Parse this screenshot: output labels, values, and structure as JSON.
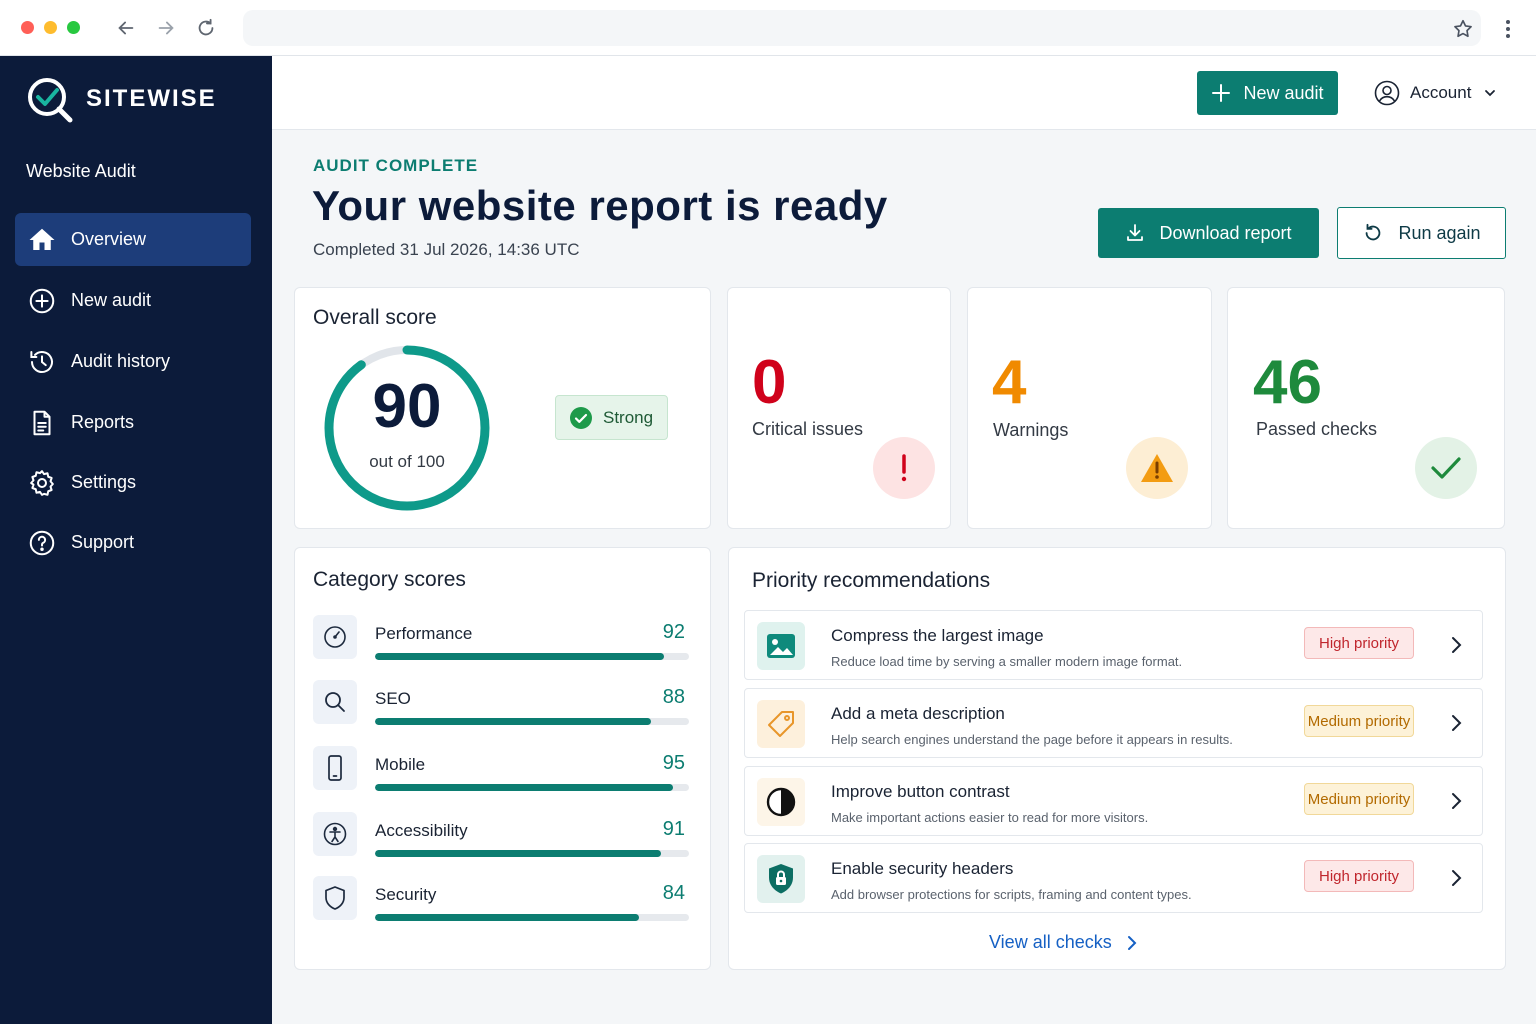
{
  "browser": {
    "url": ""
  },
  "brand": {
    "name": "SITEWISE",
    "subtitle": "Website Audit"
  },
  "sidebar": {
    "items": [
      {
        "label": "Overview",
        "icon": "home-icon",
        "active": true
      },
      {
        "label": "New audit",
        "icon": "plus-circle-icon"
      },
      {
        "label": "Audit history",
        "icon": "history-icon"
      },
      {
        "label": "Reports",
        "icon": "document-icon"
      },
      {
        "label": "Settings",
        "icon": "gear-icon"
      },
      {
        "label": "Support",
        "icon": "help-icon"
      }
    ]
  },
  "header": {
    "new_audit_label": "New audit",
    "account_label": "Account"
  },
  "hero": {
    "eyebrow": "AUDIT COMPLETE",
    "title": "Your website report is ready",
    "completed": "Completed 31 Jul 2026, 14:36 UTC",
    "download_label": "Download report",
    "run_again_label": "Run again"
  },
  "overall": {
    "title": "Overall score",
    "score": "90",
    "out_of": "out of 100",
    "fraction": 0.9,
    "badge": "Strong"
  },
  "stats": [
    {
      "value": "0",
      "label": "Critical issues",
      "color": "#d0021b",
      "icon": "exclamation-icon"
    },
    {
      "value": "4",
      "label": "Warnings",
      "color": "#f08a00",
      "icon": "warning-icon"
    },
    {
      "value": "46",
      "label": "Passed checks",
      "color": "#1e8a3c",
      "icon": "check-icon"
    }
  ],
  "categories": {
    "title": "Category scores",
    "items": [
      {
        "label": "Performance",
        "score": "92",
        "fraction": 0.92,
        "icon": "speedometer-icon"
      },
      {
        "label": "SEO",
        "score": "88",
        "fraction": 0.88,
        "icon": "search-icon"
      },
      {
        "label": "Mobile",
        "score": "95",
        "fraction": 0.95,
        "icon": "mobile-icon"
      },
      {
        "label": "Accessibility",
        "score": "91",
        "fraction": 0.91,
        "icon": "accessibility-icon"
      },
      {
        "label": "Security",
        "score": "84",
        "fraction": 0.84,
        "icon": "shield-icon"
      }
    ]
  },
  "recommendations": {
    "title": "Priority recommendations",
    "items": [
      {
        "title": "Compress the largest image",
        "desc": "Reduce load time by serving a smaller modern image format.",
        "priority": "High priority",
        "level": "high",
        "icon": "image-icon"
      },
      {
        "title": "Add a meta description",
        "desc": "Help search engines understand the page before it appears in results.",
        "priority": "Medium priority",
        "level": "medium",
        "icon": "tag-icon"
      },
      {
        "title": "Improve button contrast",
        "desc": "Make important actions easier to read for more visitors.",
        "priority": "Medium priority",
        "level": "medium",
        "icon": "contrast-icon"
      },
      {
        "title": "Enable security headers",
        "desc": "Add browser protections for scripts, framing and content types.",
        "priority": "High priority",
        "level": "high",
        "icon": "shield-lock-icon"
      }
    ],
    "view_all": "View all checks"
  },
  "colors": {
    "accent": "#0c7d71",
    "sidebar": "#0c1b3a",
    "active_nav": "#1d3d7a",
    "link": "#1560c4"
  }
}
